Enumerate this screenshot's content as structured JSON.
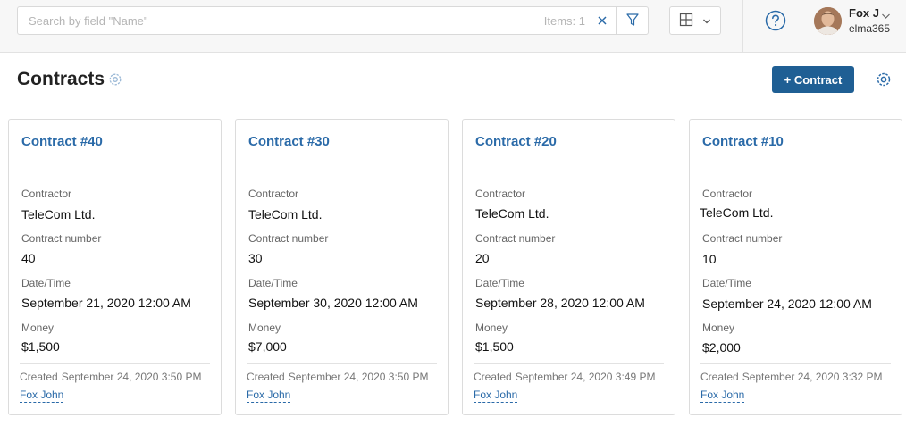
{
  "search": {
    "placeholder": "Search by field \"Name\"",
    "value": "",
    "items_count": "Items: 1"
  },
  "user": {
    "name": "Fox J",
    "company": "elma365"
  },
  "page": {
    "title": "Contracts",
    "add_button": "+ Contract"
  },
  "icons": {
    "clear": "close-icon",
    "filter": "filter-icon",
    "view": "grid-icon",
    "help": "question-icon",
    "settings": "gear-icon",
    "chevron": "chevron-down-icon"
  },
  "colors": {
    "accent": "#1f5f94",
    "link": "#2a6aa8"
  },
  "field_labels": {
    "contractor": "Contractor",
    "contract_number": "Contract number",
    "datetime": "Date/Time",
    "money": "Money",
    "created": "Created"
  },
  "cards": [
    {
      "title": "Contract #40",
      "contractor": "TeleCom Ltd.",
      "number": "40",
      "datetime": "September 21, 2020 12:00 AM",
      "money": "$1,500",
      "created": "September 24, 2020 3:50 PM",
      "author": "Fox John"
    },
    {
      "title": "Contract #30",
      "contractor": "TeleCom Ltd.",
      "number": "30",
      "datetime": "September 30, 2020 12:00 AM",
      "money": "$7,000",
      "created": "September 24, 2020 3:50 PM",
      "author": "Fox John"
    },
    {
      "title": "Contract #20",
      "contractor": "TeleCom Ltd.",
      "number": "20",
      "datetime": "September 28, 2020 12:00 AM",
      "money": "$1,500",
      "created": "September 24, 2020 3:49 PM",
      "author": "Fox John"
    },
    {
      "title": "Contract #10",
      "contractor": "TeleCom Ltd.",
      "number": "10",
      "datetime": "September 24, 2020 12:00 AM",
      "money": "$2,000",
      "created": "September 24, 2020 3:32 PM",
      "author": "Fox John"
    }
  ]
}
